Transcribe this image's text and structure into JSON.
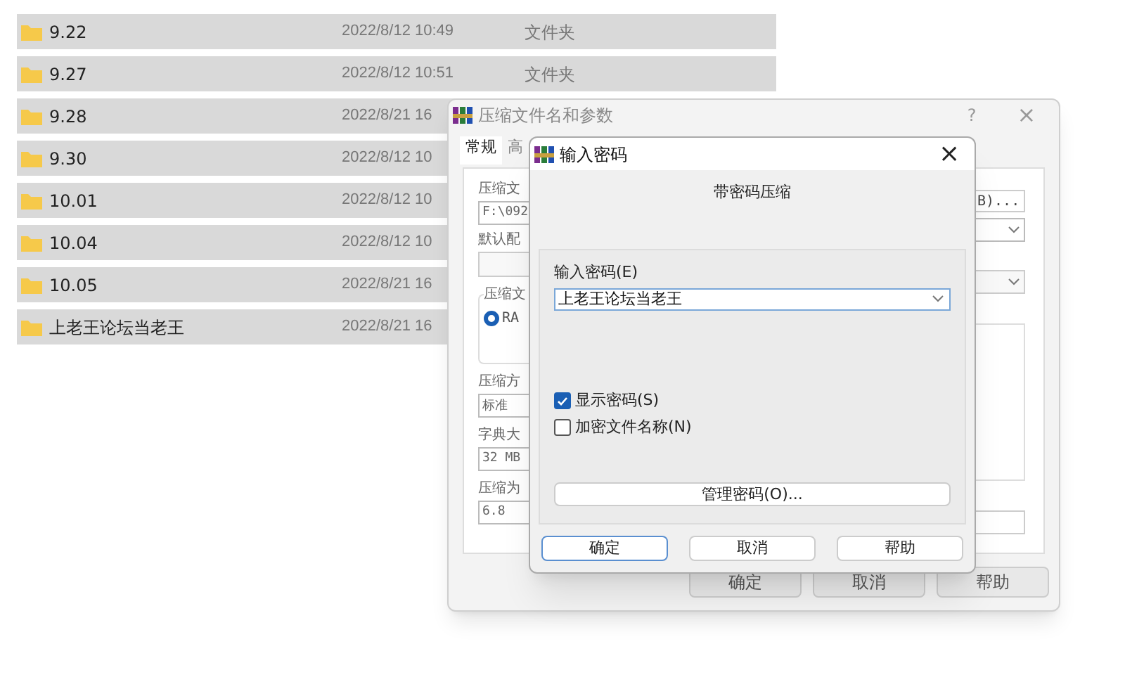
{
  "files": [
    {
      "name": "9.22",
      "modified": "2022/8/12 10:49",
      "type": "文件夹"
    },
    {
      "name": "9.27",
      "modified": "2022/8/12 10:51",
      "type": "文件夹"
    },
    {
      "name": "9.28",
      "modified": "2022/8/21 16"
    },
    {
      "name": "9.30",
      "modified": "2022/8/12 10"
    },
    {
      "name": "10.01",
      "modified": "2022/8/12 10"
    },
    {
      "name": "10.04",
      "modified": "2022/8/12 10"
    },
    {
      "name": "10.05",
      "modified": "2022/8/21 16"
    },
    {
      "name": "上老王论坛当老王",
      "modified": "2022/8/21 16"
    }
  ],
  "archive_dialog": {
    "title": "压缩文件名和参数",
    "help": "?",
    "close": "×",
    "tabs": [
      {
        "label": "常规",
        "selected": true
      },
      {
        "label": "高",
        "selected": false
      }
    ],
    "archive_name_label": "压缩文",
    "archive_name": "F:\\092",
    "browse_button": "B)...",
    "profile_label": "默认配",
    "format_group": "压缩文",
    "format_radio": {
      "label": "RA",
      "selected": true
    },
    "method_label": "压缩方",
    "method": "标准",
    "dictionary_label": "字典大",
    "dictionary": "32 MB",
    "split_label": "压缩为",
    "split": "6.8",
    "buttons": [
      "确定",
      "取消",
      "帮助"
    ]
  },
  "password_dialog": {
    "title": "输入密码",
    "close": "×",
    "heading": "带密码压缩",
    "password_label": "输入密码(E)",
    "password": "上老王论坛当老王",
    "options": [
      {
        "label": "显示密码(S)",
        "checked": true
      },
      {
        "label": "加密文件名称(N)",
        "checked": false
      }
    ],
    "manage_button": "管理密码(O)...",
    "buttons": [
      {
        "label": "确定",
        "default": true
      },
      {
        "label": "取消",
        "default": false
      },
      {
        "label": "帮助",
        "default": false
      }
    ]
  }
}
